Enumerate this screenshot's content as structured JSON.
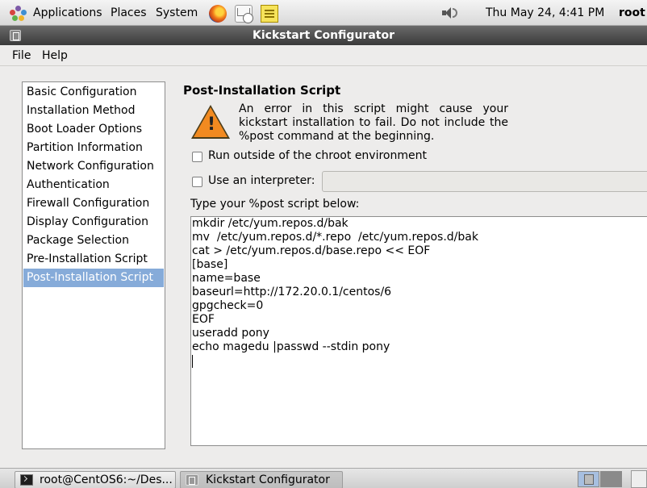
{
  "top_panel": {
    "menus": [
      "Applications",
      "Places",
      "System"
    ],
    "launchers": [
      "firefox-icon",
      "mail-icon",
      "notes-icon"
    ],
    "clock": "Thu May 24,  4:41 PM",
    "user": "root"
  },
  "window": {
    "title": "Kickstart Configurator",
    "menu": [
      "File",
      "Help"
    ]
  },
  "sidebar": {
    "items": [
      "Basic Configuration",
      "Installation Method",
      "Boot Loader Options",
      "Partition Information",
      "Network Configuration",
      "Authentication",
      "Firewall Configuration",
      "Display Configuration",
      "Package Selection",
      "Pre-Installation Script",
      "Post-Installation Script"
    ],
    "selected": "Post-Installation Script"
  },
  "main": {
    "section_title": "Post-Installation Script",
    "warning_text": "An error in this script might cause your kickstart installation to fail. Do not include the %post command at the beginning.",
    "chroot_label": "Run outside of the chroot environment",
    "chroot_checked": false,
    "interpreter_label": "Use an interpreter:",
    "interpreter_checked": false,
    "interpreter_value": "",
    "script_label": "Type your %post script below:",
    "script_lines": [
      "mkdir /etc/yum.repos.d/bak",
      "mv  /etc/yum.repos.d/*.repo  /etc/yum.repos.d/bak",
      "cat > /etc/yum.repos.d/base.repo << EOF",
      "[base]",
      "name=base",
      "baseurl=http://172.20.0.1/centos/6",
      "gpgcheck=0",
      "EOF",
      "useradd pony",
      "echo magedu |passwd --stdin pony"
    ]
  },
  "taskbar": {
    "tasks": [
      "root@CentOS6:~/Des...",
      "Kickstart Configurator"
    ],
    "active_task": "Kickstart Configurator"
  }
}
